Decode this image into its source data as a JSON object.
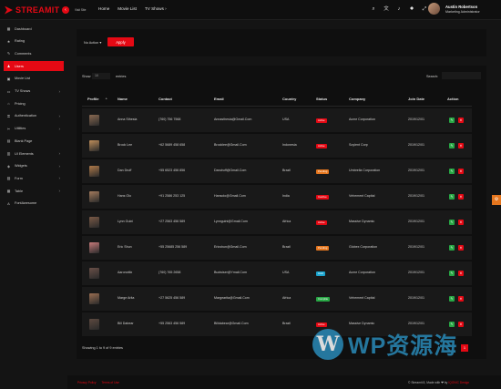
{
  "brand": {
    "name": "STREAMIT"
  },
  "header": {
    "visit_site": "Visit Site",
    "nav": [
      "Home",
      "Movie List",
      "TV Shows"
    ],
    "user": {
      "name": "Austin Robertson",
      "role": "Marketing Administrator"
    }
  },
  "sidebar": {
    "items": [
      {
        "label": "Dashboard",
        "icon": "dashboard-icon",
        "arrow": false,
        "active": false
      },
      {
        "label": "Rating",
        "icon": "star-icon",
        "arrow": false,
        "active": false
      },
      {
        "label": "Comments",
        "icon": "comment-icon",
        "arrow": false,
        "active": false
      },
      {
        "label": "Users",
        "icon": "user-icon",
        "arrow": false,
        "active": true
      },
      {
        "label": "Movie List",
        "icon": "film-icon",
        "arrow": false,
        "active": false
      },
      {
        "label": "TV Shows",
        "icon": "tv-icon",
        "arrow": true,
        "active": false
      },
      {
        "label": "Pricing",
        "icon": "tag-icon",
        "arrow": false,
        "active": false
      },
      {
        "label": "Authentication",
        "icon": "lock-icon",
        "arrow": true,
        "active": false
      },
      {
        "label": "Utilities",
        "icon": "tool-icon",
        "arrow": true,
        "active": false
      },
      {
        "label": "Blank Page",
        "icon": "page-icon",
        "arrow": false,
        "active": false
      },
      {
        "label": "UI Elements",
        "icon": "grid-icon",
        "arrow": true,
        "active": false
      },
      {
        "label": "Widgets",
        "icon": "widget-icon",
        "arrow": true,
        "active": false
      },
      {
        "label": "Form",
        "icon": "form-icon",
        "arrow": true,
        "active": false
      },
      {
        "label": "Table",
        "icon": "table-icon",
        "arrow": true,
        "active": false
      },
      {
        "label": "FontAwesome",
        "icon": "font-icon",
        "arrow": false,
        "active": false
      }
    ]
  },
  "bulk": {
    "selected": "No Action",
    "apply": "Apply"
  },
  "table_controls": {
    "show": "Show",
    "page_size": "10",
    "entries": "entries",
    "search": "Search:"
  },
  "table": {
    "headers": [
      "Profile",
      "Name",
      "Contact",
      "Email",
      "Country",
      "Status",
      "Company",
      "Join Date",
      "Action"
    ],
    "rows": [
      {
        "name": "Anna Sthesia",
        "contact": "(760) 756 7568",
        "email": "Annasthesia@Gmail.Com",
        "country": "USA",
        "status": "Active",
        "company": "Acme Corporation",
        "date": "2019/12/01"
      },
      {
        "name": "Brock Lee",
        "contact": "+62 5689 458 658",
        "email": "Brocklee@Gmail.Com",
        "country": "Indonesia",
        "status": "Active",
        "company": "Soylent Corp",
        "date": "2019/12/01"
      },
      {
        "name": "Dan Druff",
        "contact": "+55 6523 456 856",
        "email": "Dandruff@Gmail.Com",
        "country": "Brazil",
        "status": "Pending",
        "company": "Umbrella Corporation",
        "date": "2019/12/01"
      },
      {
        "name": "Hans Olo",
        "contact": "+91 2586 253 125",
        "email": "Hansolo@Gmail.Com",
        "country": "India",
        "status": "Inactive",
        "company": "Vehement Capital",
        "date": "2019/12/01"
      },
      {
        "name": "Lynn Guini",
        "contact": "+27 2563 456 589",
        "email": "Lynnguini@Gmail.Com",
        "country": "Africa",
        "status": "Active",
        "company": "Massive Dynamic",
        "date": "2019/12/01"
      },
      {
        "name": "Eric Shun",
        "contact": "+55 25685 256 589",
        "email": "Ericshun@Gmail.Com",
        "country": "Brazil",
        "status": "Pending",
        "company": "Globex Corporation",
        "date": "2019/12/01"
      },
      {
        "name": "Aaronottix",
        "contact": "(760) 765 2658",
        "email": "Budwiser@Ymail.Com",
        "country": "USA",
        "status": "Hold",
        "company": "Acme Corporation",
        "date": "2019/12/01"
      },
      {
        "name": "Marge Arita",
        "contact": "+27 5625 456 589",
        "email": "Margearita@Gmail.Com",
        "country": "Africa",
        "status": "Complite",
        "company": "Vehement Capital",
        "date": "2019/12/01"
      },
      {
        "name": "Bill Dabear",
        "contact": "+55 2563 456 589",
        "email": "Billdabear@Gmail.Com",
        "country": "Brazil",
        "status": "Active",
        "company": "Massive Dynamic",
        "date": "2019/12/01"
      }
    ]
  },
  "status_colors": {
    "Active": "#e50914",
    "Pending": "#e5761e",
    "Inactive": "#e50914",
    "Hold": "#1ba5cf",
    "Complite": "#28a745"
  },
  "action_colors": {
    "edit": "#28a745",
    "delete": "#e50914"
  },
  "pagination": {
    "info": "Showing 1 to 9 of 9 entries",
    "page": "1"
  },
  "footer": {
    "links": [
      "Privacy Policy",
      "Terms of Use"
    ],
    "copyright": "© Streamit 8, Made with ❤ by",
    "copyright_link": "IQONIC Design"
  },
  "watermark": {
    "text": "WP资源海"
  }
}
